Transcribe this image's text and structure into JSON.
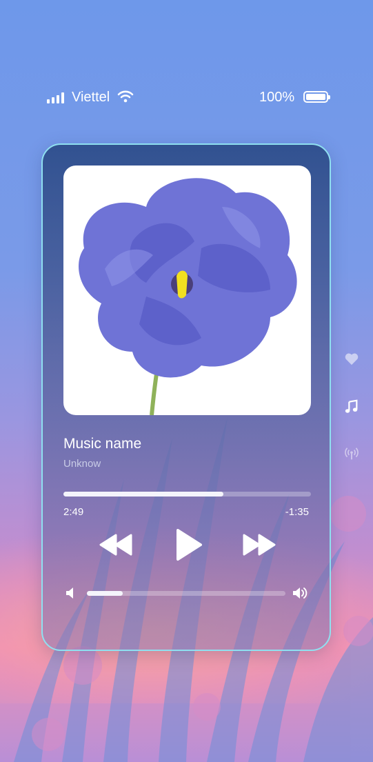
{
  "status_bar": {
    "carrier": "Viettel",
    "battery_percent": "100%"
  },
  "player": {
    "song_title": "Music name",
    "artist": "Unknow",
    "elapsed": "2:49",
    "remaining": "-1:35",
    "progress_fraction": 0.645,
    "volume_fraction": 0.18,
    "cover_art": "purple-lisianthus-flower"
  },
  "side_icons": [
    "heart-icon",
    "music-note-icon",
    "broadcast-icon"
  ],
  "colors": {
    "card_border": "#8fe0f0",
    "flower": "#6f73d6",
    "text_primary": "#ffffff",
    "text_secondary": "#c9cce6"
  }
}
